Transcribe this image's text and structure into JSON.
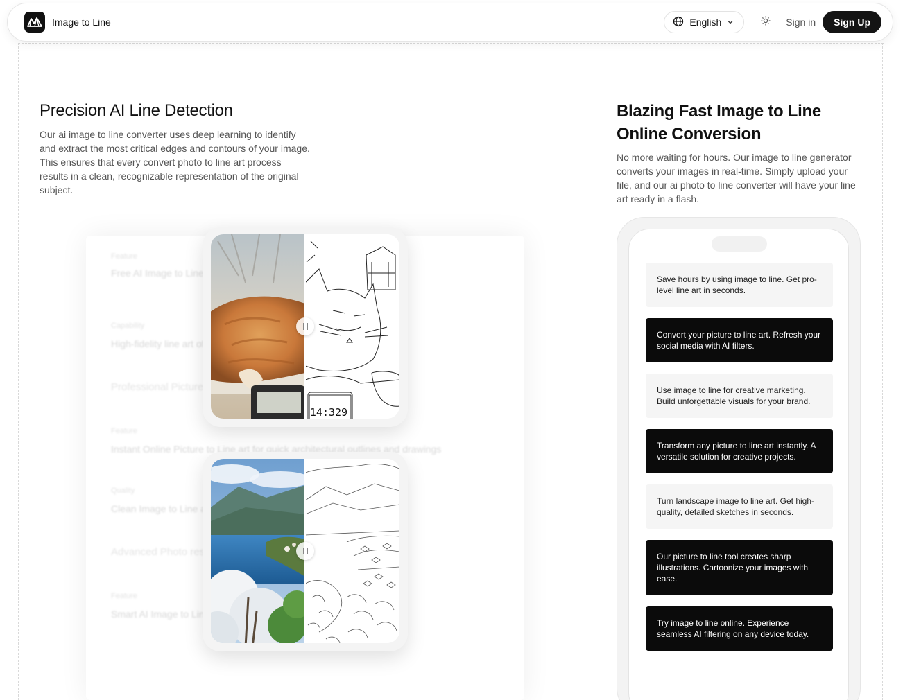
{
  "header": {
    "brand": "Image to Line",
    "language": "English",
    "signin": "Sign in",
    "signup": "Sign Up"
  },
  "left": {
    "title": "Precision AI Line Detection",
    "description": "Our ai image to line converter uses deep learning to identify and extract the most critical edges and contours of your image. This ensures that every convert photo to line art process results in a clean, recognizable representation of the original subject."
  },
  "faded": [
    {
      "kind": "label",
      "text": "Feature"
    },
    {
      "kind": "row",
      "text": "Free AI Image to Line"
    },
    {
      "kind": "label",
      "text": "Capability"
    },
    {
      "kind": "row",
      "text": "High-fidelity line art of your photos"
    },
    {
      "kind": "head",
      "text": "Professional Picture"
    },
    {
      "kind": "label",
      "text": "Feature"
    },
    {
      "kind": "row",
      "text": "Instant Online Picture to Line art for quick architectural outlines and drawings"
    },
    {
      "kind": "label",
      "text": "Quality"
    },
    {
      "kind": "row",
      "text": "Clean Image to Line art creators"
    },
    {
      "kind": "head",
      "text": "Advanced Photo results"
    },
    {
      "kind": "label",
      "text": "Feature"
    },
    {
      "kind": "row",
      "text": "Smart AI Image to Line technology"
    }
  ],
  "compare_cards": [
    {
      "name": "cat",
      "readout": "14:329"
    },
    {
      "name": "landscape"
    }
  ],
  "right": {
    "title": "Blazing Fast Image to Line Online Conversion",
    "description": "No more waiting for hours. Our image to line generator converts your images in real-time. Simply upload your file, and our ai photo to line converter will have your line art ready in a flash.",
    "messages": [
      {
        "style": "light",
        "text": "Save hours by using image to line. Get pro-level line art in seconds."
      },
      {
        "style": "dark",
        "text": "Convert your picture to line art. Refresh your social media with AI filters."
      },
      {
        "style": "light",
        "text": "Use image to line for creative marketing. Build unforgettable visuals for your brand."
      },
      {
        "style": "dark",
        "text": "Transform any picture to line art instantly. A versatile solution for creative projects."
      },
      {
        "style": "light",
        "text": "Turn landscape image to line art. Get high-quality, detailed sketches in seconds."
      },
      {
        "style": "dark",
        "text": "Our picture to line tool creates sharp illustrations. Cartoonize your images with ease."
      },
      {
        "style": "dark",
        "text": "Try image to line online. Experience seamless AI filtering on any device today."
      }
    ]
  },
  "colors": {
    "accent": "#141414",
    "muted_text": "#555555",
    "card_bg": "#f5f5f5"
  }
}
